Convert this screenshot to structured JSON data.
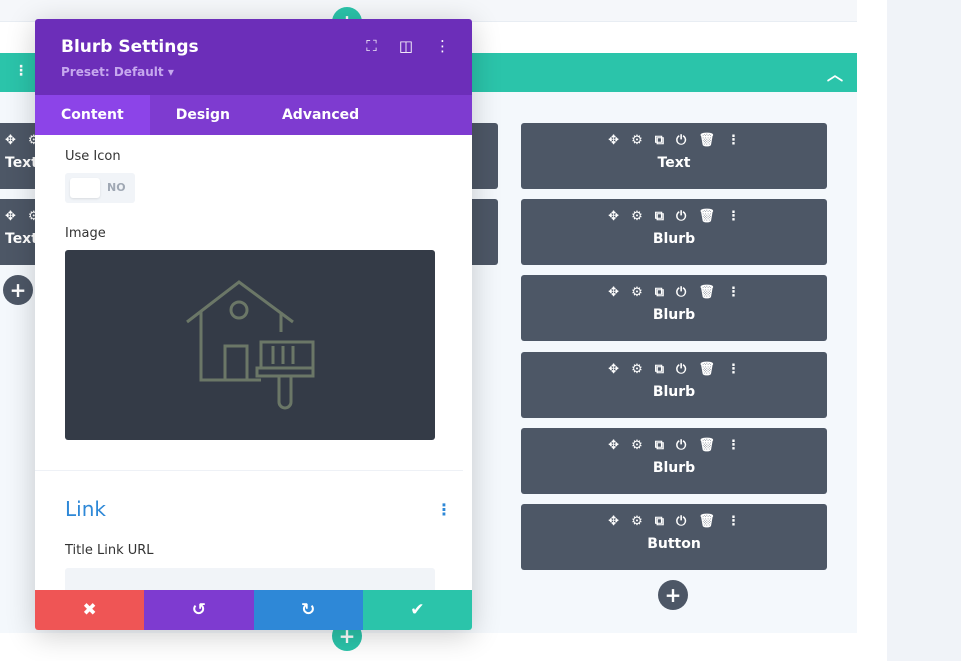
{
  "colors": {
    "header": "#6c2eb9",
    "tabs": "#7e3bd0",
    "active_tab": "#8c44e8",
    "row_bar": "#2bc4aa",
    "module": "#4d5766",
    "cancel": "#ef5555",
    "undo": "#7e3bd0",
    "redo": "#2e88d7",
    "save": "#2bc4aa",
    "link": "#2e88d7"
  },
  "modal": {
    "title": "Blurb Settings",
    "preset": "Preset: Default ▾",
    "header_icons": [
      "fullscreen-icon",
      "split-view-icon",
      "more-icon"
    ],
    "tabs": [
      {
        "label": "Content",
        "active": true
      },
      {
        "label": "Design"
      },
      {
        "label": "Advanced"
      }
    ],
    "use_icon": {
      "label": "Use Icon",
      "value": "NO"
    },
    "image": {
      "label": "Image",
      "icon": "house-paintbrush-icon"
    },
    "link_section": {
      "title": "Link",
      "title_link_url_label": "Title Link URL",
      "title_link_url_value": ""
    },
    "footer": [
      {
        "icon": "close-icon",
        "glyph": "✖"
      },
      {
        "icon": "undo-icon",
        "glyph": "↺"
      },
      {
        "icon": "redo-icon",
        "glyph": "↻"
      },
      {
        "icon": "check-icon",
        "glyph": "✔"
      }
    ]
  },
  "module_icons": [
    "✥",
    "⚙",
    "⧉",
    "⏻",
    "🗑",
    "⋮"
  ],
  "left_modules": [
    "Text",
    "Text"
  ],
  "right_modules": [
    "Text",
    "Blurb",
    "Blurb",
    "Blurb",
    "Blurb",
    "Button"
  ],
  "add_glyph": "+"
}
